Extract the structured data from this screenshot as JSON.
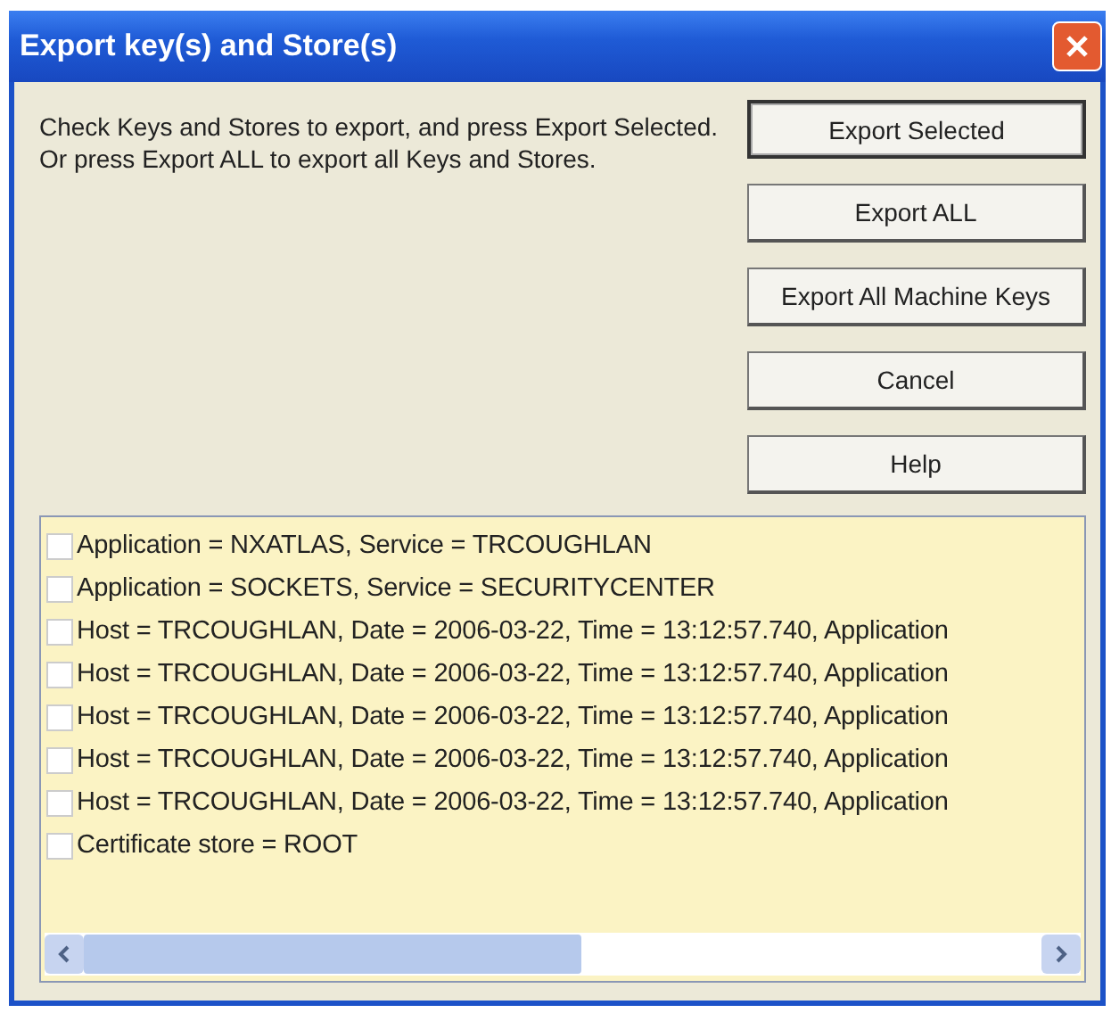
{
  "window": {
    "title": "Export key(s) and Store(s)"
  },
  "instructions": "Check Keys and Stores to export, and  press Export Selected.  Or press Export ALL to export all Keys and Stores.",
  "buttons": [
    {
      "label": "Export Selected",
      "default": true
    },
    {
      "label": "Export ALL",
      "default": false
    },
    {
      "label": "Export All Machine Keys",
      "default": false
    },
    {
      "label": "Cancel",
      "default": false
    },
    {
      "label": "Help",
      "default": false
    }
  ],
  "items": [
    {
      "label": "Application = NXATLAS, Service = TRCOUGHLAN",
      "checked": false
    },
    {
      "label": "Application = SOCKETS, Service = SECURITYCENTER",
      "checked": false
    },
    {
      "label": "Host = TRCOUGHLAN, Date = 2006-03-22,  Time = 13:12:57.740, Application",
      "checked": false
    },
    {
      "label": "Host = TRCOUGHLAN, Date = 2006-03-22,  Time = 13:12:57.740, Application",
      "checked": false
    },
    {
      "label": "Host = TRCOUGHLAN, Date = 2006-03-22,  Time = 13:12:57.740, Application",
      "checked": false
    },
    {
      "label": "Host = TRCOUGHLAN, Date = 2006-03-22,  Time = 13:12:57.740, Application",
      "checked": false
    },
    {
      "label": "Host = TRCOUGHLAN, Date = 2006-03-22,  Time = 13:12:57.740, Application",
      "checked": false
    },
    {
      "label": "Certificate store = ROOT",
      "checked": false
    }
  ]
}
